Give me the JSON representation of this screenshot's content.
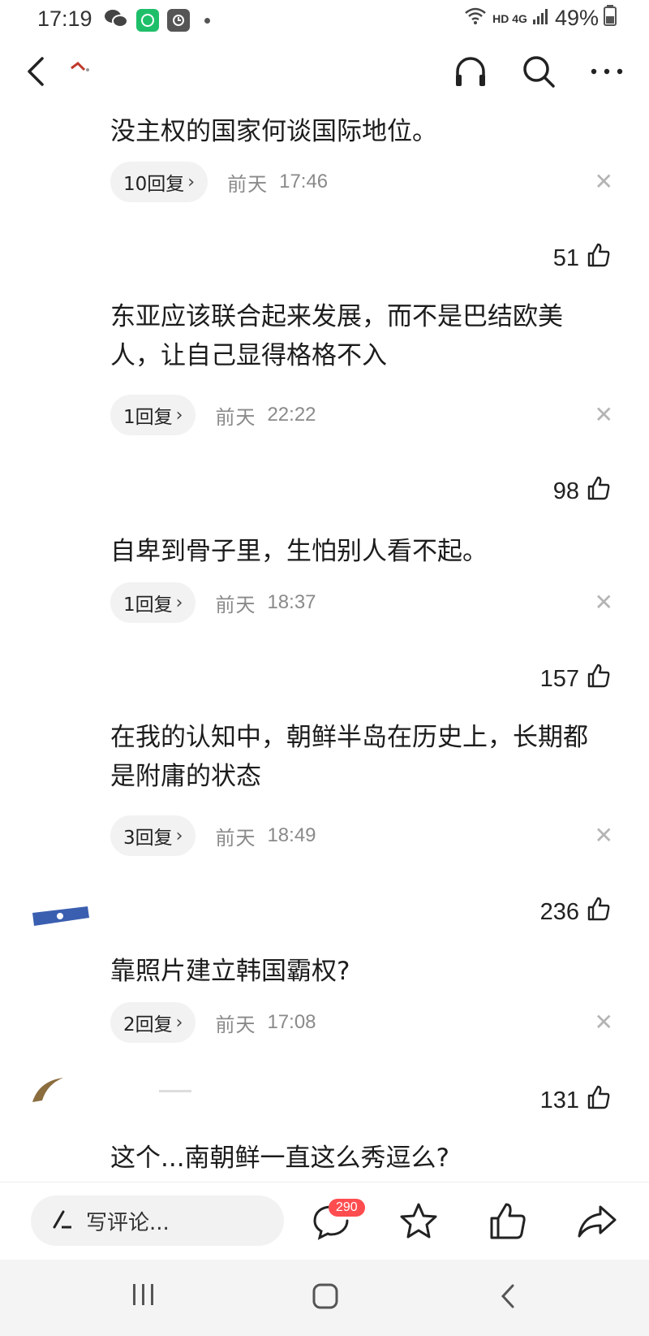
{
  "status_bar": {
    "time": "17:19",
    "network": "HD 4G",
    "battery": "49%"
  },
  "comments": [
    {
      "likes": "",
      "text": "没主权的国家何谈国际地位。",
      "replies": "10回复",
      "date": "前天",
      "time": "17:46"
    },
    {
      "likes": "51",
      "text": "东亚应该联合起来发展，而不是巴结欧美人，让自己显得格格不入",
      "replies": "1回复",
      "date": "前天",
      "time": "22:22"
    },
    {
      "likes": "98",
      "text": "自卑到骨子里，生怕别人看不起。",
      "replies": "1回复",
      "date": "前天",
      "time": "18:37"
    },
    {
      "likes": "157",
      "text": "在我的认知中，朝鲜半岛在历史上，长期都是附庸的状态",
      "replies": "3回复",
      "date": "前天",
      "time": "18:49"
    },
    {
      "likes": "236",
      "text": "靠照片建立韩国霸权?",
      "replies": "2回复",
      "date": "前天",
      "time": "17:08"
    },
    {
      "likes": "131",
      "text": "这个...南朝鲜一直这么秀逗么?",
      "replies": "",
      "date": "",
      "time": ""
    }
  ],
  "bottom_bar": {
    "placeholder": "写评论...",
    "comment_count": "290"
  },
  "colors": {
    "badge": "#ff4d4f",
    "pill_bg": "#f2f2f2",
    "meta_text": "#8a8a8a"
  }
}
